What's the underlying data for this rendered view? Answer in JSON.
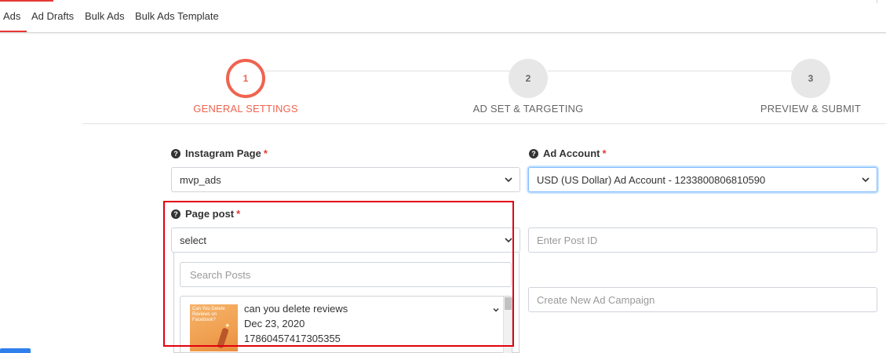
{
  "tabs": [
    {
      "label": "Ads"
    },
    {
      "label": "Ad Drafts"
    },
    {
      "label": "Bulk Ads"
    },
    {
      "label": "Bulk Ads Template"
    }
  ],
  "stepper": {
    "steps": [
      {
        "number": "1",
        "label": "GENERAL SETTINGS",
        "state": "active"
      },
      {
        "number": "2",
        "label": "AD SET & TARGETING",
        "state": "inactive"
      },
      {
        "number": "3",
        "label": "PREVIEW & SUBMIT",
        "state": "inactive"
      }
    ]
  },
  "form": {
    "instagram_page": {
      "label": "Instagram Page",
      "required_mark": "*",
      "value": "mvp_ads"
    },
    "ad_account": {
      "label": "Ad Account",
      "required_mark": "*",
      "value": "USD (US Dollar) Ad Account - 1233800806810590"
    },
    "page_post": {
      "label": "Page post",
      "required_mark": "*",
      "value": "select"
    },
    "post_id": {
      "placeholder": "Enter Post ID"
    },
    "ad_campaign": {
      "placeholder": "Create New Ad Campaign"
    },
    "help_icon": "?"
  },
  "dropdown": {
    "search_placeholder": "Search Posts",
    "posts": [
      {
        "title": "can you delete reviews",
        "date": "Dec 23, 2020",
        "id": "17860457417305355",
        "thumbnail_text": [
          "Can You Delete",
          "Reviews on",
          "Facebook?"
        ]
      }
    ]
  },
  "colors": {
    "accent": "#ef6450",
    "brand_red": "#e53935",
    "highlight": "#e3000f"
  }
}
